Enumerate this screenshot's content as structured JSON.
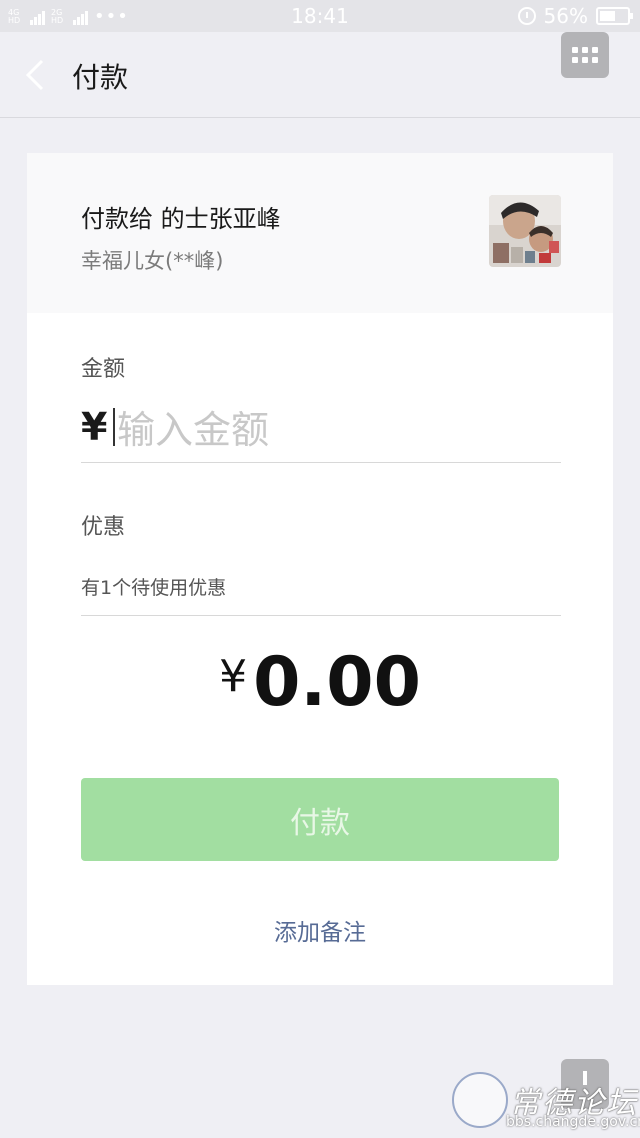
{
  "status_bar": {
    "signal1_label": "4G HD",
    "signal2_label": "2G HD",
    "time": "18:41",
    "battery": "56%",
    "battery_level": 0.56
  },
  "nav": {
    "title": "付款",
    "back_icon": "chevron-left-icon",
    "menu_icon": "more-grid-icon"
  },
  "payee": {
    "title": "付款给 的士张亚峰",
    "subtitle": "幸福儿女(**峰)"
  },
  "amount": {
    "label": "金额",
    "currency": "¥",
    "placeholder": "输入金额"
  },
  "discount": {
    "label": "优惠",
    "text": "有1个待使用优惠"
  },
  "total": {
    "currency": "¥",
    "value": "0.00"
  },
  "pay_button": {
    "label": "付款"
  },
  "add_note": "添加备注",
  "watermark": {
    "title": "常德论坛",
    "url": "bbs.changde.gov.cn"
  },
  "colors": {
    "pay_button_disabled": "#a2dea1",
    "link": "#576b95",
    "background": "#efeff4"
  }
}
